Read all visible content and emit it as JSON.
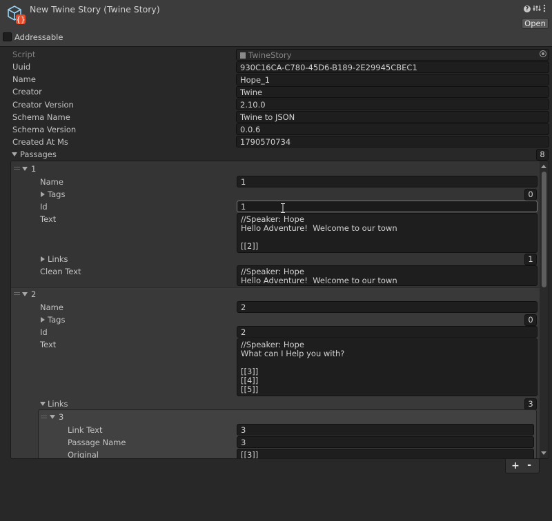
{
  "header": {
    "title": "New Twine Story (Twine Story)",
    "open_label": "Open",
    "addressable_label": "Addressable",
    "addressable_checked": false,
    "help_icon": "?"
  },
  "props": {
    "script_label": "Script",
    "script_value": "TwineStory",
    "uuid_label": "Uuid",
    "uuid_value": "930C16CA-C780-45D6-B189-2E29945CBEC1",
    "name_label": "Name",
    "name_value": "Hope_1",
    "creator_label": "Creator",
    "creator_value": "Twine",
    "creator_version_label": "Creator Version",
    "creator_version_value": "2.10.0",
    "schema_name_label": "Schema Name",
    "schema_name_value": "Twine to JSON",
    "schema_version_label": "Schema Version",
    "schema_version_value": "0.0.6",
    "created_at_label": "Created At Ms",
    "created_at_value": "1790570734"
  },
  "passages": {
    "label": "Passages",
    "count": "8",
    "items": [
      {
        "index": "1",
        "name_label": "Name",
        "name_value": "1",
        "tags_label": "Tags",
        "tags_count": "0",
        "id_label": "Id",
        "id_value": "1",
        "text_label": "Text",
        "text_value": "//Speaker: Hope\nHello Adventure!  Welcome to our town\n\n[[2]]",
        "links_label": "Links",
        "links_count": "1",
        "clean_text_label": "Clean Text",
        "clean_text_value": "//Speaker: Hope\nHello Adventure!  Welcome to our town"
      },
      {
        "index": "2",
        "name_label": "Name",
        "name_value": "2",
        "tags_label": "Tags",
        "tags_count": "0",
        "id_label": "Id",
        "id_value": "2",
        "text_label": "Text",
        "text_value": "//Speaker: Hope\nWhat can I Help you with?\n\n[[3]]\n[[4]]\n[[5]]",
        "links_label": "Links",
        "links_count": "3",
        "link": {
          "index": "3",
          "link_text_label": "Link Text",
          "link_text_value": "3",
          "passage_name_label": "Passage Name",
          "passage_name_value": "3",
          "original_label": "Original",
          "original_value": "[[3]]"
        }
      }
    ]
  },
  "footer": {
    "add_label": "+",
    "remove_label": "-"
  }
}
